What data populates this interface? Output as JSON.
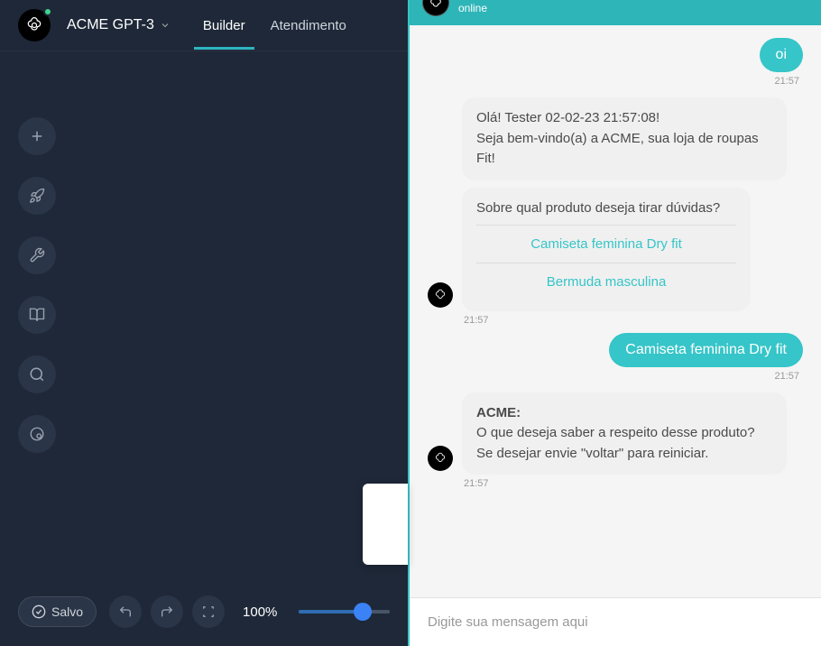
{
  "header": {
    "app_title": "ACME GPT-3",
    "tabs": [
      {
        "label": "Builder",
        "active": true
      },
      {
        "label": "Atendimento",
        "active": false
      }
    ]
  },
  "bottom": {
    "save_label": "Salvo",
    "zoom_label": "100%"
  },
  "chat": {
    "status": "online",
    "input_placeholder": "Digite sua mensagem aqui",
    "messages": {
      "u1": {
        "text": "oi",
        "time": "21:57"
      },
      "b1": {
        "text": "Olá! Tester 02-02-23 21:57:08!\nSeja bem-vindo(a) a ACME, sua loja de roupas Fit!"
      },
      "b2": {
        "text": "Sobre qual produto deseja tirar dúvidas?",
        "options": [
          "Camiseta feminina Dry fit",
          "Bermuda masculina"
        ],
        "time": "21:57"
      },
      "u2": {
        "text": "Camiseta feminina Dry fit",
        "time": "21:57"
      },
      "b3": {
        "label": "ACME:",
        "text": "O que deseja saber a respeito desse produto? Se desejar envie \"voltar\" para reiniciar.",
        "time": "21:57"
      }
    }
  }
}
